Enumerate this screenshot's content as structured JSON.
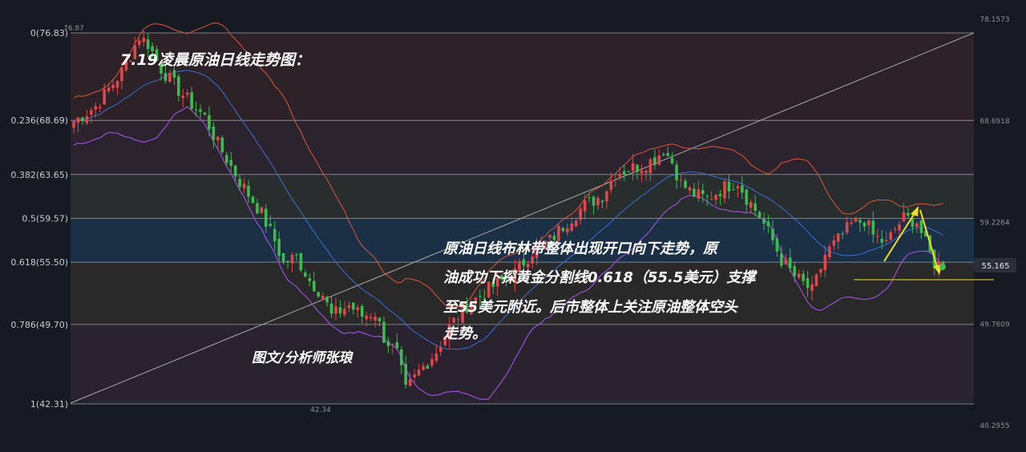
{
  "chart_data": {
    "type": "candlestick",
    "title": "7.19凌晨原油日线走势图：",
    "author_note": "图文/分析师张琅",
    "commentary": [
      "原油日线布林带整体出现开口向下走势，原",
      "油成功下探黄金分割线0.618（55.5美元）支撑",
      "至55美元附近。后市整体上关注原油整体空头",
      "走势。"
    ],
    "fibonacci_levels": [
      {
        "label": "0(76.83)",
        "ratio": 0,
        "price": 76.83
      },
      {
        "label": "0.236(68.69)",
        "ratio": 0.236,
        "price": 68.69
      },
      {
        "label": "0.382(63.65)",
        "ratio": 0.382,
        "price": 63.65
      },
      {
        "label": "0.5(59.57)",
        "ratio": 0.5,
        "price": 59.57
      },
      {
        "label": "0.618(55.50)",
        "ratio": 0.618,
        "price": 55.5
      },
      {
        "label": "0.786(49.70)",
        "ratio": 0.786,
        "price": 49.7
      },
      {
        "label": "1(42.31)",
        "ratio": 1,
        "price": 42.31
      }
    ],
    "right_axis_ticks": [
      {
        "label": "78.1573",
        "value": 78.1573
      },
      {
        "label": "68.6918",
        "value": 68.6918
      },
      {
        "label": "59.2264",
        "value": 59.2264
      },
      {
        "label": "49.7609",
        "value": 49.7609
      },
      {
        "label": "40.2955",
        "value": 40.2955
      }
    ],
    "current_price": {
      "label": "55.165",
      "value": 55.165
    },
    "extreme_labels": [
      {
        "label": "76.87",
        "value": 76.87
      },
      {
        "label": "42.34",
        "value": 42.34
      }
    ],
    "support_level": 55.5,
    "ylim": [
      40.2955,
      78.1573
    ],
    "colors": {
      "up": "#e0464a",
      "down": "#3fb950",
      "bb_upper": "#e0553c",
      "bb_middle": "#3d6fd8",
      "bb_lower": "#9b4fd8",
      "annotation_arrow": "#f0e020",
      "fib_line": "#c8c8c8",
      "background": "#161a23"
    },
    "close_path": [
      [
        0,
        68.6
      ],
      [
        5,
        70.0
      ],
      [
        11,
        73.2
      ],
      [
        15,
        76.5
      ],
      [
        17,
        75.8
      ],
      [
        20,
        73.5
      ],
      [
        24,
        71.5
      ],
      [
        27,
        70.2
      ],
      [
        30,
        69.0
      ],
      [
        33,
        66.5
      ],
      [
        38,
        63.0
      ],
      [
        43,
        60.0
      ],
      [
        46,
        57.5
      ],
      [
        48,
        55.4
      ],
      [
        51,
        56.0
      ],
      [
        54,
        53.8
      ],
      [
        57,
        52.5
      ],
      [
        59,
        50.5
      ],
      [
        63,
        51.5
      ],
      [
        66,
        50.5
      ],
      [
        69,
        50.8
      ],
      [
        71,
        48.5
      ],
      [
        74,
        47.0
      ],
      [
        76,
        43.5
      ],
      [
        79,
        45.3
      ],
      [
        83,
        47.2
      ],
      [
        86,
        49.5
      ],
      [
        90,
        51.5
      ],
      [
        95,
        53.0
      ],
      [
        101,
        54.5
      ],
      [
        105,
        56.5
      ],
      [
        109,
        57.5
      ],
      [
        113,
        59.3
      ],
      [
        117,
        60.8
      ],
      [
        121,
        61.7
      ],
      [
        124,
        63.8
      ],
      [
        127,
        64.2
      ],
      [
        130,
        64.5
      ],
      [
        133,
        65.1
      ],
      [
        135,
        66.0
      ],
      [
        137,
        64.8
      ],
      [
        139,
        62.8
      ],
      [
        142,
        61.8
      ],
      [
        145,
        61.4
      ],
      [
        149,
        62.5
      ],
      [
        152,
        63.0
      ],
      [
        154,
        61.5
      ],
      [
        157,
        59.8
      ],
      [
        160,
        57.5
      ],
      [
        162,
        55.7
      ],
      [
        165,
        54.2
      ],
      [
        167,
        53.5
      ],
      [
        169,
        52.8
      ],
      [
        170,
        53.8
      ],
      [
        172,
        56.2
      ],
      [
        175,
        57.6
      ],
      [
        178,
        59.0
      ],
      [
        181,
        59.4
      ],
      [
        183,
        58.0
      ],
      [
        186,
        57.2
      ],
      [
        188,
        58.6
      ],
      [
        190,
        59.6
      ],
      [
        193,
        59.3
      ],
      [
        195,
        57.2
      ],
      [
        197,
        55.4
      ],
      [
        199,
        55.3
      ]
    ]
  }
}
